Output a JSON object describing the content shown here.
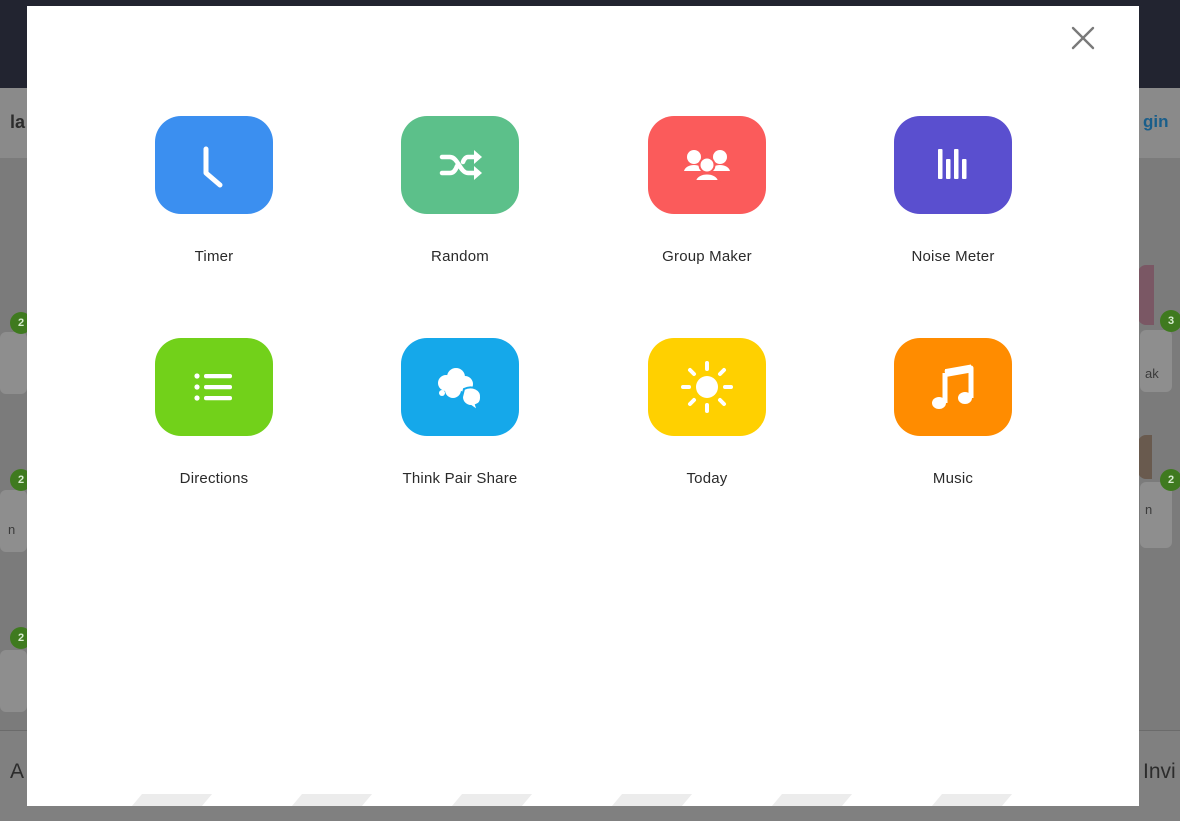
{
  "background": {
    "left_title_fragment": "la",
    "login_fragment": "gin",
    "left_footer_fragment": "A",
    "right_footer_fragment": "Invi",
    "badges": [
      "2",
      "3",
      "2",
      "2",
      "2"
    ],
    "card_fragments": [
      "ak",
      "n",
      "n"
    ]
  },
  "modal": {
    "close_icon": "close-icon",
    "tools": [
      {
        "label": "Timer",
        "icon": "clock-icon",
        "color": "#3b8ff0"
      },
      {
        "label": "Random",
        "icon": "shuffle-icon",
        "color": "#5cc08a"
      },
      {
        "label": "Group Maker",
        "icon": "group-icon",
        "color": "#fb5b5b"
      },
      {
        "label": "Noise Meter",
        "icon": "equalizer-icon",
        "color": "#5a4fcf"
      },
      {
        "label": "Directions",
        "icon": "list-icon",
        "color": "#72d11a"
      },
      {
        "label": "Think Pair Share",
        "icon": "speech-bubbles-icon",
        "color": "#15a8ea"
      },
      {
        "label": "Today",
        "icon": "sun-icon",
        "color": "#ffd000"
      },
      {
        "label": "Music",
        "icon": "music-note-icon",
        "color": "#ff8c00"
      }
    ]
  }
}
